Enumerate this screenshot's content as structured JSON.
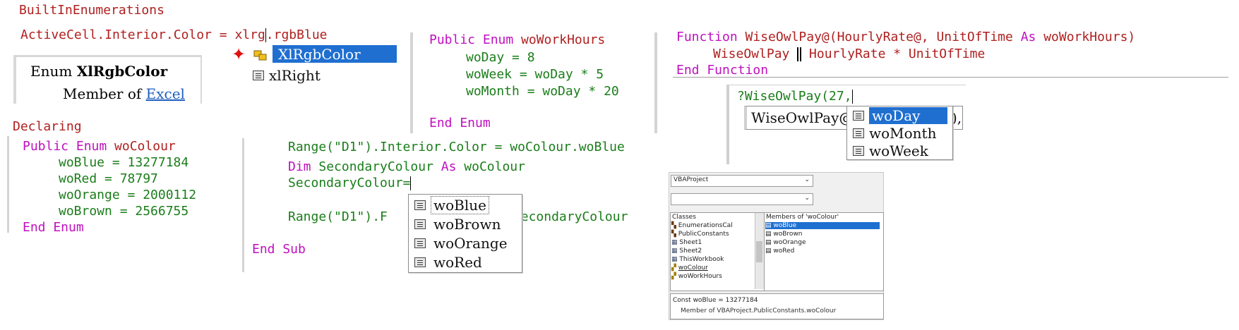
{
  "section1": {
    "heading": "BuiltInEnumerations",
    "code_prefix": "ActiveCell.Interior.Color = ",
    "code_typed": "xlrg",
    "code_suffix": ".rgbBlue",
    "tooltip_keyword": "Enum ",
    "tooltip_name": "XlRgbColor",
    "tooltip_member_of": "Member of ",
    "tooltip_link": "Excel",
    "list": [
      {
        "label": "XlRgbColor",
        "selected": true
      },
      {
        "label": "xlRight",
        "selected": false
      }
    ]
  },
  "enum_work_hours": {
    "line1_kw": "Public Enum ",
    "line1_name": "woWorkHours",
    "lines": [
      "woDay = 8",
      "woWeek = woDay * 5",
      "woMonth = woDay * 20"
    ],
    "end": "End Enum"
  },
  "function_block": {
    "kw_function": "Function ",
    "sig_a": "WiseOwlPay@(HourlyRate@, UnitOfTime ",
    "kw_as": "As",
    "sig_b": " woWorkHours)",
    "body_a": "WiseOwlPay ",
    "body_b": " HourlyRate * UnitOfTime",
    "end": "End Function",
    "immediate_text": "?WiseOwlPay(27,",
    "tip_text": "WiseOwlPay@",
    "tip_tail": "),",
    "list": [
      {
        "label": "woDay",
        "selected": true
      },
      {
        "label": "woMonth",
        "selected": false
      },
      {
        "label": "woWeek",
        "selected": false
      }
    ]
  },
  "declaring": {
    "heading": "Declaring",
    "line1_kw": "Public Enum ",
    "line1_name": "woColour",
    "lines": [
      "woBlue = 13277184",
      "woRed = 78797",
      "woOrange = 2000112",
      "woBrown = 2566755"
    ],
    "end": "End Enum"
  },
  "using": {
    "line1": "Range(\"D1\").Interior.Color = woColour.woBlue",
    "line2_kw": "Dim ",
    "line2_a": "SecondaryColour ",
    "line2_as": "As",
    "line2_b": " woColour",
    "line3": "SecondaryColour=",
    "line4_a": "Range(\"D1\").F",
    "line4_b": "SecondaryColour",
    "end_sub": "End Sub",
    "list": [
      {
        "label": "woBlue",
        "selected": false
      },
      {
        "label": "woBrown",
        "selected": false
      },
      {
        "label": "woOrange",
        "selected": false
      },
      {
        "label": "woRed",
        "selected": false
      }
    ]
  },
  "object_browser": {
    "project": "VBAProject",
    "classes_header": "Classes",
    "classes": [
      "EnumerationsCal",
      "PublicConstants",
      "Sheet1",
      "Sheet2",
      "ThisWorkbook",
      "woColour",
      "woWorkHours"
    ],
    "members_header": "Members of 'woColour'",
    "members": [
      "woBlue",
      "woBrown",
      "woOrange",
      "woRed"
    ],
    "selected_member": "woBlue",
    "detail_line1": "Const woBlue = 13277184",
    "detail_line2": "Member of VBAProject.PublicConstants.woColour"
  },
  "colors": {
    "keyword": "#c010c0",
    "text": "#1a7d1a",
    "heading": "#b02020",
    "selection": "#1f6fd0"
  }
}
